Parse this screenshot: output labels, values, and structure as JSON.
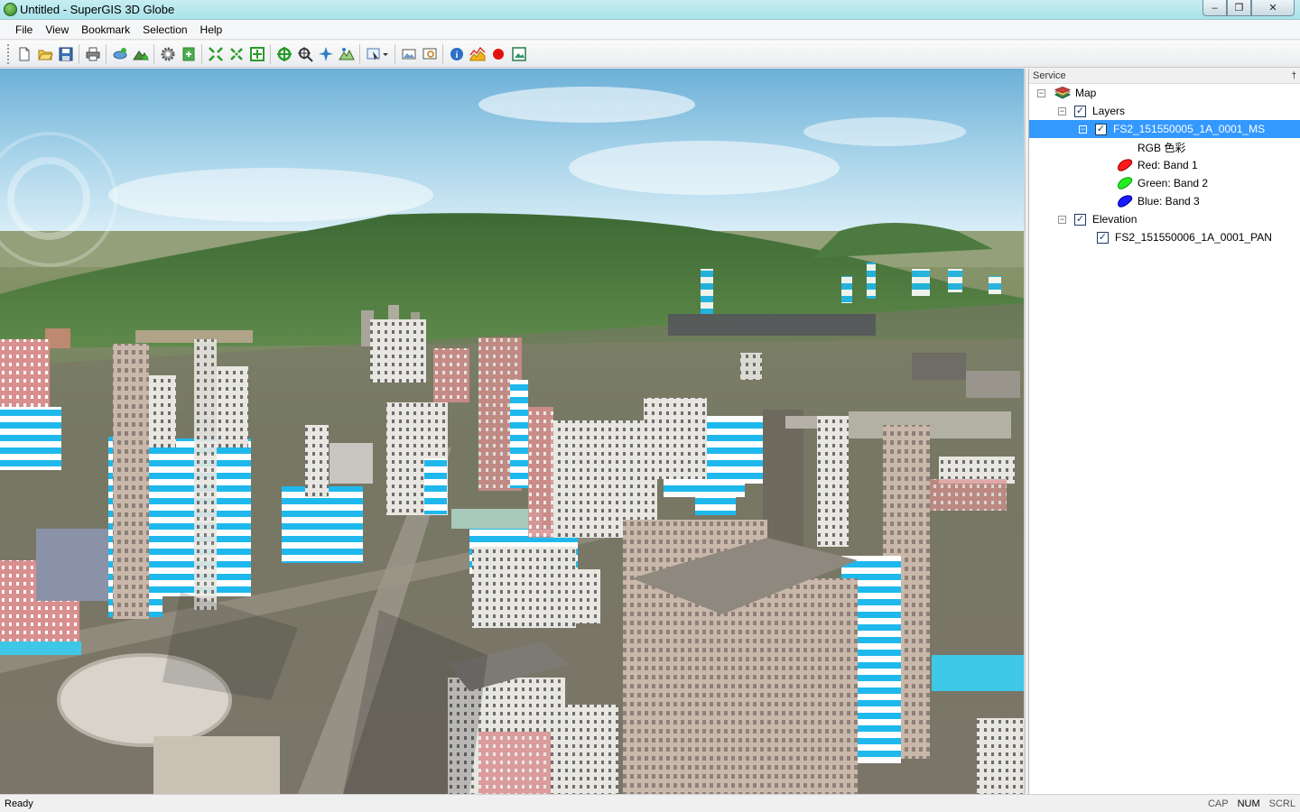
{
  "window": {
    "title": "Untitled - SuperGIS 3D Globe",
    "minimize": "–",
    "maximize": "❐",
    "close": "✕"
  },
  "menu": [
    "File",
    "View",
    "Bookmark",
    "Selection",
    "Help"
  ],
  "toolbar": {
    "icons": [
      "new-document-icon",
      "open-folder-icon",
      "save-icon",
      "print-icon",
      "add-layer-icon",
      "add-elevation-icon",
      "settings-gear-icon",
      "export-icon",
      "full-extent-icon",
      "zoom-extent-icon",
      "zoom-layer-icon",
      "navigate-icon",
      "target-icon",
      "fly-icon",
      "terrain-icon",
      "select-tool-icon",
      "image-icon",
      "zoom-window-icon",
      "info-icon",
      "profile-chart-icon",
      "record-icon",
      "capture-icon"
    ]
  },
  "panel": {
    "title": "Service",
    "pin": "†",
    "tree": {
      "map": "Map",
      "layers": "Layers",
      "ms_layer": "FS2_151550005_1A_0001_MS",
      "rgb": "RGB 色彩",
      "red": "Red: Band 1",
      "green": "Green: Band 2",
      "blue": "Blue: Band 3",
      "elevation": "Elevation",
      "pan_layer": "FS2_151550006_1A_0001_PAN"
    }
  },
  "status": {
    "text": "Ready",
    "cap": "CAP",
    "num": "NUM",
    "scrl": "SCRL"
  },
  "colors": {
    "selection": "#3399ff",
    "band_red": "#ff1a1a",
    "band_green": "#22ee22",
    "band_blue": "#1a1aff"
  }
}
